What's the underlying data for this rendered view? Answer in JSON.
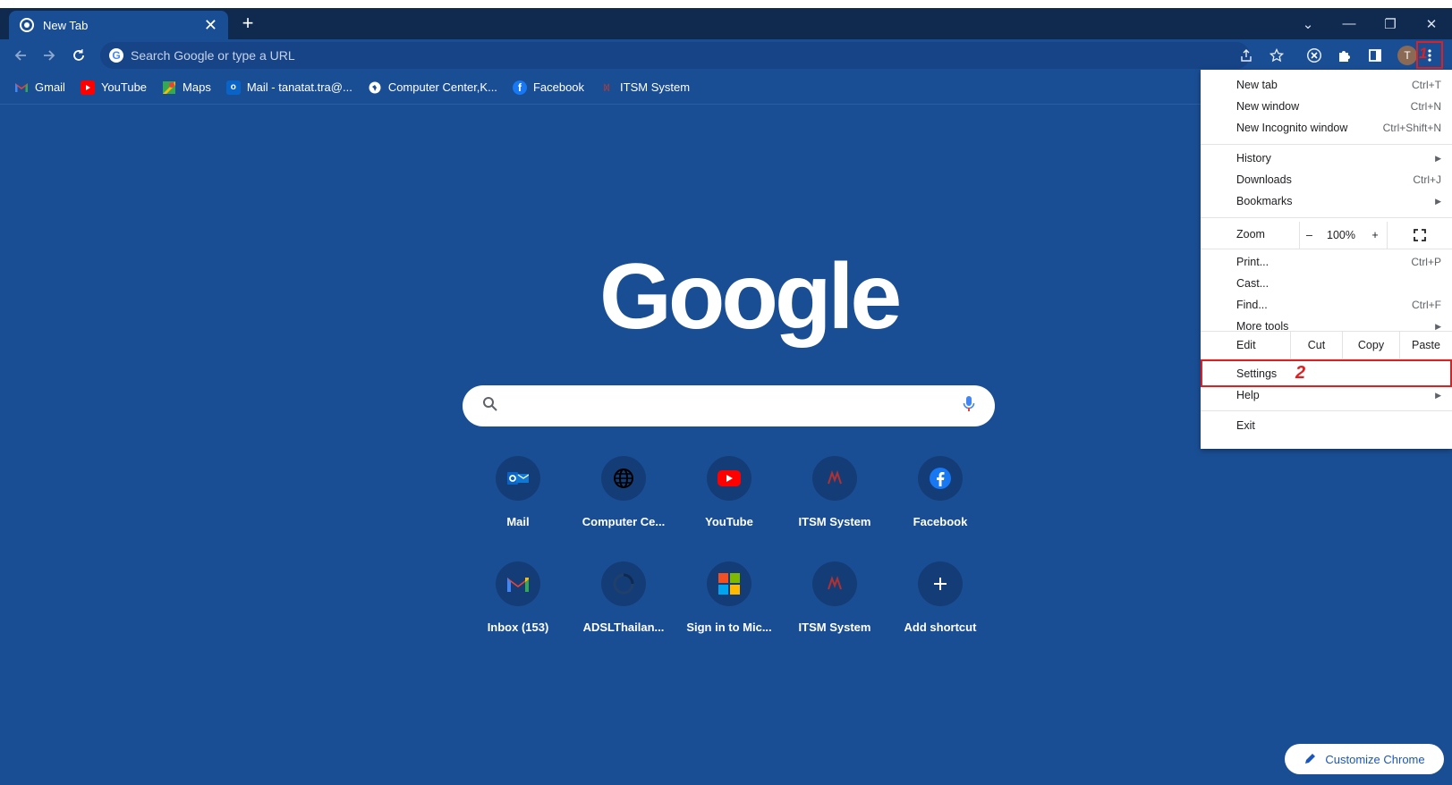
{
  "tab": {
    "title": "New Tab",
    "close": "✕",
    "new_tab": "+"
  },
  "window_controls": {
    "dropdown": "⌄",
    "minimize": "—",
    "restore": "❐",
    "close": "✕"
  },
  "omnibox": {
    "placeholder": "Search Google or type a URL"
  },
  "profile": {
    "initial": "T"
  },
  "annotations": {
    "step1": "1",
    "step2": "2"
  },
  "bookmarks": [
    {
      "label": "Gmail",
      "icon": "gmail-icon"
    },
    {
      "label": "YouTube",
      "icon": "youtube-icon"
    },
    {
      "label": "Maps",
      "icon": "maps-icon"
    },
    {
      "label": "Mail - tanatat.tra@...",
      "icon": "outlook-icon"
    },
    {
      "label": "Computer Center,K...",
      "icon": "globe-icon"
    },
    {
      "label": "Facebook",
      "icon": "facebook-icon"
    },
    {
      "label": "ITSM System",
      "icon": "itsm-icon"
    }
  ],
  "ntp": {
    "logo_text": "Google",
    "shortcuts_row1": [
      "Mail",
      "Computer Ce...",
      "YouTube",
      "ITSM System",
      "Facebook"
    ],
    "shortcuts_row2": [
      "Inbox (153)",
      "ADSLThailan...",
      "Sign in to Mic...",
      "ITSM System",
      "Add shortcut"
    ],
    "customize": "Customize Chrome"
  },
  "menu": {
    "new_tab": {
      "label": "New tab",
      "key": "Ctrl+T"
    },
    "new_window": {
      "label": "New window",
      "key": "Ctrl+N"
    },
    "incognito": {
      "label": "New Incognito window",
      "key": "Ctrl+Shift+N"
    },
    "history": {
      "label": "History"
    },
    "downloads": {
      "label": "Downloads",
      "key": "Ctrl+J"
    },
    "bookmarks": {
      "label": "Bookmarks"
    },
    "zoom": {
      "label": "Zoom",
      "minus": "–",
      "value": "100%",
      "plus": "+"
    },
    "print": {
      "label": "Print...",
      "key": "Ctrl+P"
    },
    "cast": {
      "label": "Cast..."
    },
    "find": {
      "label": "Find...",
      "key": "Ctrl+F"
    },
    "more_tools": {
      "label": "More tools"
    },
    "edit": {
      "label": "Edit",
      "cut": "Cut",
      "copy": "Copy",
      "paste": "Paste"
    },
    "settings": {
      "label": "Settings"
    },
    "help": {
      "label": "Help"
    },
    "exit": {
      "label": "Exit"
    }
  },
  "colors": {
    "chrome_blue": "#1a4e94",
    "tabstrip": "#102a4f",
    "annotation_red": "#e02020"
  }
}
